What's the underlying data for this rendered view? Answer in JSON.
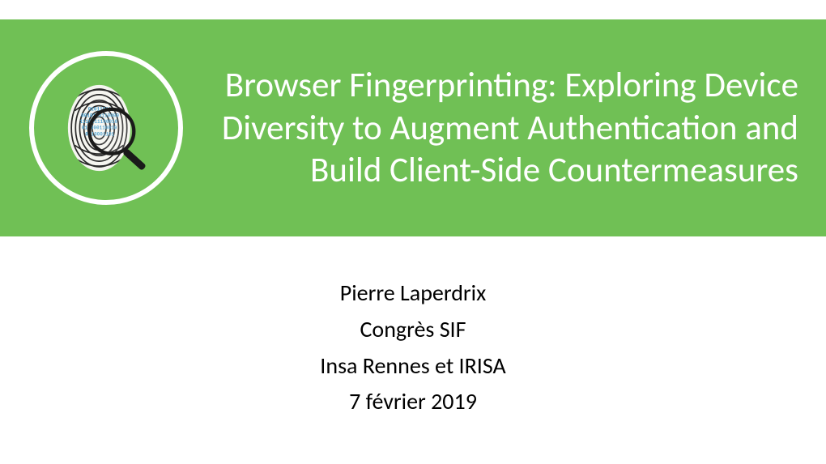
{
  "title": "Browser Fingerprinting: Exploring Device Diversity to Augment Authentication and Build Client-Side Countermeasures",
  "author": "Pierre Laperdrix",
  "event": "Congrès SIF",
  "affiliation": "Insa Rennes et IRISA",
  "date": "7 février 2019",
  "logo": {
    "semantic": "fingerprint-magnifier-icon",
    "binary_lines": [
      "01011011",
      "0010110110000",
      "1110011100010",
      "011000110010",
      "0110001101"
    ]
  }
}
